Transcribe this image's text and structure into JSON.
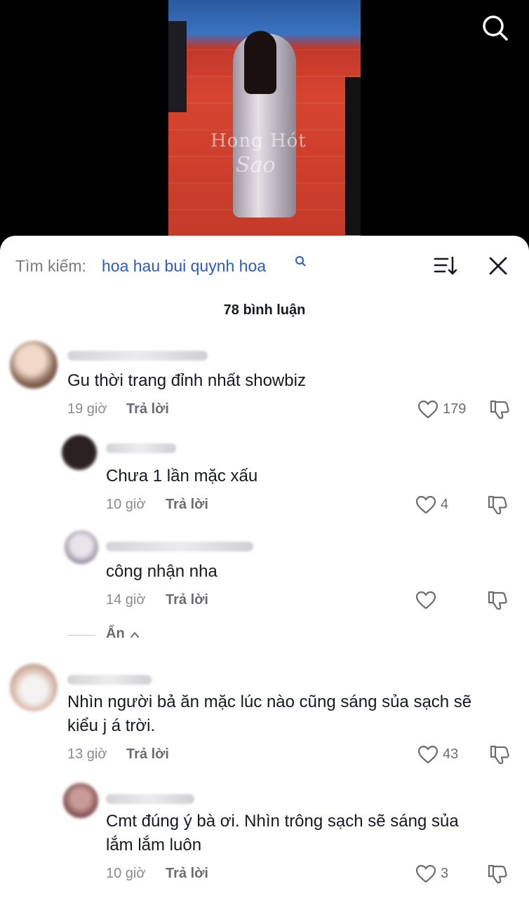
{
  "video": {
    "watermark_line1": "Hong Hót",
    "watermark_line2": "Sao"
  },
  "header": {
    "search_label": "Tìm kiếm:",
    "search_query": "hoa hau bui quynh hoa",
    "comment_count": "78 bình luận"
  },
  "icons": {
    "top_search": "search-icon",
    "sort": "sort-icon",
    "close": "close-icon",
    "like": "heart-icon",
    "dislike": "thumbs-down-icon"
  },
  "comments": [
    {
      "text": "Gu thời trang đỉnh nhất showbiz",
      "time": "19 giờ",
      "reply": "Trả lời",
      "likes": "179"
    },
    {
      "text": "Chưa 1 lần mặc xấu",
      "time": "10 giờ",
      "reply": "Trả lời",
      "likes": "4"
    },
    {
      "text": "công nhận nha",
      "time": "14 giờ",
      "reply": "Trả lời",
      "likes": ""
    },
    {
      "text": "Nhìn người bả ăn mặc lúc nào cũng sáng sủa sạch sẽ",
      "text2": "kiểu j á trời.",
      "time": "13 giờ",
      "reply": "Trả lời",
      "likes": "43"
    },
    {
      "text": "Cmt đúng ý bà ơi. Nhìn trông sạch sẽ sáng sủa",
      "text2": "lắm lắm luôn",
      "time": "10 giờ",
      "reply": "Trả lời",
      "likes": "3"
    }
  ],
  "hide_replies": "Ẩn",
  "colors": {
    "accent": "#2a5cc4",
    "text": "#161823",
    "muted": "#8a8b91"
  }
}
